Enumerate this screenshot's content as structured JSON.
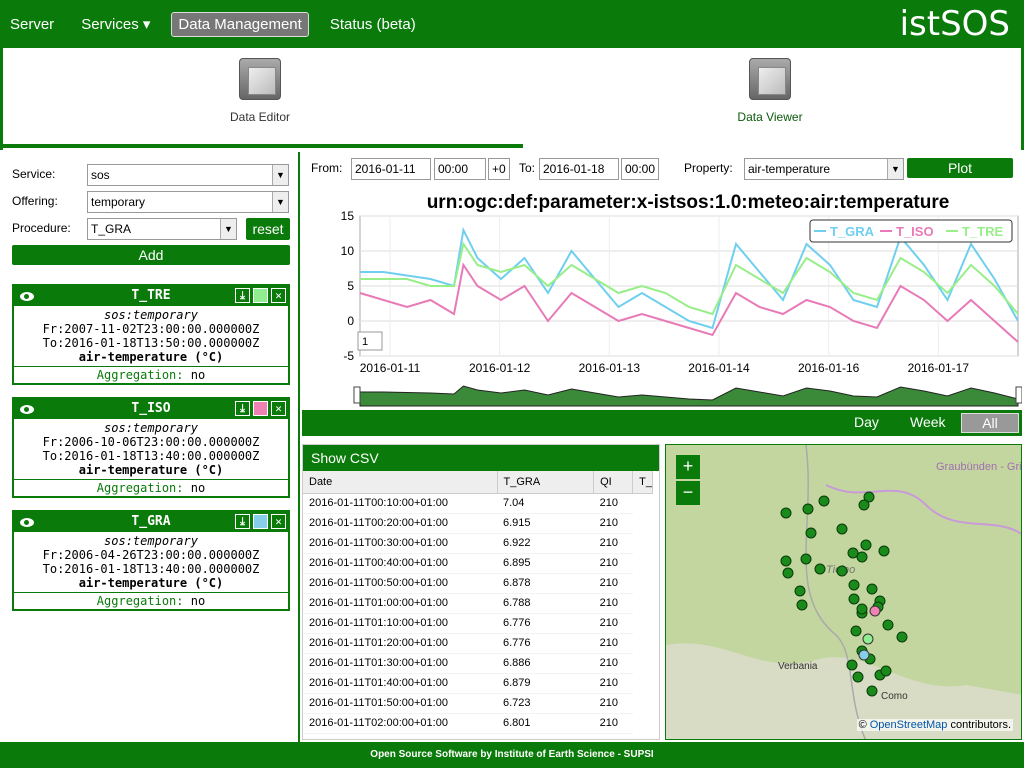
{
  "nav": {
    "items": [
      {
        "label": "Server"
      },
      {
        "label": "Services ▾"
      },
      {
        "label": "Data Management"
      },
      {
        "label": "Status (beta)"
      }
    ],
    "logo_text": "istSOS"
  },
  "tools": {
    "editor_label": "Data Editor",
    "viewer_label": "Data Viewer"
  },
  "form": {
    "service_label": "Service:",
    "service_value": "sos",
    "offering_label": "Offering:",
    "offering_value": "temporary",
    "procedure_label": "Procedure:",
    "procedure_value": "T_GRA",
    "reset_label": "reset",
    "add_label": "Add"
  },
  "cards": [
    {
      "name": "T_TRE",
      "color": "#90ee90",
      "offering": "sos:temporary",
      "from": "Fr:2007-11-02T23:00:00.000000Z",
      "to": "To:2016-01-18T13:50:00.000000Z",
      "property": "air-temperature (°C)",
      "agg_label": "Aggregation:",
      "agg_value": "no"
    },
    {
      "name": "T_ISO",
      "color": "#ee82b4",
      "offering": "sos:temporary",
      "from": "Fr:2006-10-06T23:00:00.000000Z",
      "to": "To:2016-01-18T13:40:00.000000Z",
      "property": "air-temperature (°C)",
      "agg_label": "Aggregation:",
      "agg_value": "no"
    },
    {
      "name": "T_GRA",
      "color": "#87ceeb",
      "offering": "sos:temporary",
      "from": "Fr:2006-04-26T23:00:00.000000Z",
      "to": "To:2016-01-18T13:40:00.000000Z",
      "property": "air-temperature (°C)",
      "agg_label": "Aggregation:",
      "agg_value": "no"
    }
  ],
  "controls": {
    "from_label": "From:",
    "from_date": "2016-01-11",
    "from_time": "00:00",
    "tz": "+0",
    "to_label": "To:",
    "to_date": "2016-01-18",
    "to_time": "00:00",
    "property_label": "Property:",
    "property_value": "air-temperature",
    "plot_label": "Plot"
  },
  "chart_data": {
    "type": "line",
    "title": "urn:ogc:def:parameter:x-istsos:1.0:meteo:air:temperature",
    "xlabel": "",
    "ylabel": "",
    "ylim": [
      -5,
      15
    ],
    "yticks": [
      "15",
      "10",
      "5",
      "0",
      "-5"
    ],
    "xticks": [
      "2016-01-11",
      "2016-01-12",
      "2016-01-13",
      "2016-01-14",
      "2016-01-16",
      "2016-01-17"
    ],
    "roller_value": "1",
    "legend_placement": "top-right",
    "series": [
      {
        "name": "T_GRA",
        "color": "#6fcfef",
        "x": [
          0,
          0.25,
          0.5,
          0.75,
          1.0,
          1.1,
          1.25,
          1.5,
          1.75,
          2.0,
          2.25,
          2.5,
          2.75,
          3.0,
          3.25,
          3.5,
          3.75,
          4.0,
          4.25,
          4.5,
          4.75,
          5.0,
          5.25,
          5.5,
          5.75,
          6.0,
          6.25,
          6.5,
          6.75,
          7.0
        ],
        "y": [
          7,
          7,
          6.5,
          6,
          5,
          13,
          9,
          6,
          9,
          4,
          10,
          6,
          2,
          4,
          2,
          0,
          -1,
          11,
          7,
          3,
          11,
          8,
          3,
          2,
          12,
          8,
          3,
          11,
          6,
          0
        ]
      },
      {
        "name": "T_ISO",
        "color": "#e87ab8",
        "x": [
          0,
          0.25,
          0.5,
          0.75,
          1.0,
          1.1,
          1.25,
          1.5,
          1.75,
          2.0,
          2.25,
          2.5,
          2.75,
          3.0,
          3.25,
          3.5,
          3.75,
          4.0,
          4.25,
          4.5,
          4.75,
          5.0,
          5.25,
          5.5,
          5.75,
          6.0,
          6.25,
          6.5,
          6.75,
          7.0
        ],
        "y": [
          4,
          3,
          2,
          3,
          1,
          8,
          5,
          3,
          5,
          0,
          4,
          2,
          0,
          1,
          0,
          -1,
          -2,
          4,
          2,
          1,
          3,
          2,
          0,
          -1,
          5,
          3,
          0,
          3,
          0,
          -3
        ]
      },
      {
        "name": "T_TRE",
        "color": "#98ee88",
        "x": [
          0,
          0.25,
          0.5,
          0.75,
          1.0,
          1.1,
          1.25,
          1.5,
          1.75,
          2.0,
          2.25,
          2.5,
          2.75,
          3.0,
          3.25,
          3.5,
          3.75,
          4.0,
          4.25,
          4.5,
          4.75,
          5.0,
          5.25,
          5.5,
          5.75,
          6.0,
          6.25,
          6.5,
          6.75,
          7.0
        ],
        "y": [
          6,
          6,
          6,
          5,
          5,
          11,
          8,
          7,
          8,
          5,
          8,
          6,
          4,
          5,
          4,
          2,
          1,
          8,
          6,
          4,
          9,
          7,
          4,
          3,
          9,
          7,
          4,
          8,
          5,
          1
        ]
      }
    ]
  },
  "range": {
    "day": "Day",
    "week": "Week",
    "all": "All"
  },
  "csv": {
    "title": "Show CSV",
    "headers": [
      "Date",
      "T_GRA",
      "QI",
      "T_"
    ],
    "rows": [
      [
        "2016-01-11T00:10:00+01:00",
        "7.04",
        "210"
      ],
      [
        "2016-01-11T00:20:00+01:00",
        "6.915",
        "210"
      ],
      [
        "2016-01-11T00:30:00+01:00",
        "6.922",
        "210"
      ],
      [
        "2016-01-11T00:40:00+01:00",
        "6.895",
        "210"
      ],
      [
        "2016-01-11T00:50:00+01:00",
        "6.878",
        "210"
      ],
      [
        "2016-01-11T01:00:00+01:00",
        "6.788",
        "210"
      ],
      [
        "2016-01-11T01:10:00+01:00",
        "6.776",
        "210"
      ],
      [
        "2016-01-11T01:20:00+01:00",
        "6.776",
        "210"
      ],
      [
        "2016-01-11T01:30:00+01:00",
        "6.886",
        "210"
      ],
      [
        "2016-01-11T01:40:00+01:00",
        "6.879",
        "210"
      ],
      [
        "2016-01-11T01:50:00+01:00",
        "6.723",
        "210"
      ],
      [
        "2016-01-11T02:00:00+01:00",
        "6.801",
        "210"
      ]
    ]
  },
  "map": {
    "zoom_in": "+",
    "zoom_out": "−",
    "labels": [
      "Graubünden - Grischun",
      "Ticino",
      "Verbania",
      "Como"
    ],
    "attribution_prefix": "©",
    "attribution_link": "OpenStreetMap",
    "attribution_suffix": "contributors."
  },
  "footer": "Open Source Software by Institute of Earth Science - SUPSI"
}
